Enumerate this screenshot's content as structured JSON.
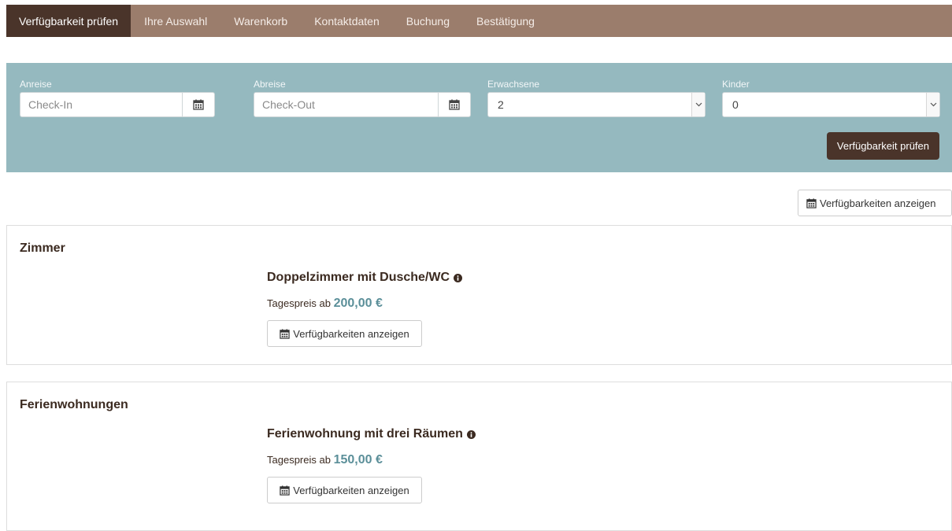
{
  "steps": [
    {
      "label": "Verfügbarkeit prüfen",
      "active": true
    },
    {
      "label": "Ihre Auswahl"
    },
    {
      "label": "Warenkorb"
    },
    {
      "label": "Kontaktdaten"
    },
    {
      "label": "Buchung"
    },
    {
      "label": "Bestätigung"
    }
  ],
  "search": {
    "arrival_label": "Anreise",
    "arrival_placeholder": "Check-In",
    "departure_label": "Abreise",
    "departure_placeholder": "Check-Out",
    "adults_label": "Erwachsene",
    "adults_value": "2",
    "children_label": "Kinder",
    "children_value": "0",
    "submit_label": "Verfügbarkeit prüfen"
  },
  "top_button_label": "Verfügbarkeiten anzeigen",
  "categories": [
    {
      "title": "Zimmer",
      "item_title": "Doppelzimmer mit Dusche/WC",
      "price_prefix": "Tagespreis ab",
      "price": "200,00 €",
      "button_label": "Verfügbarkeiten anzeigen"
    },
    {
      "title": "Ferienwohnungen",
      "item_title": "Ferienwohnung mit drei Räumen",
      "price_prefix": "Tagespreis ab",
      "price": "150,00 €",
      "button_label": "Verfügbarkeiten anzeigen"
    }
  ],
  "icons": {
    "calendar": "calendar-icon",
    "info": "info-circle-icon",
    "dropdown": "chevron-down-icon"
  },
  "colors": {
    "nav_bg": "#9b7d6c",
    "nav_active": "#4a342a",
    "search_bg": "#95b9bf",
    "price": "#5b8f99"
  }
}
